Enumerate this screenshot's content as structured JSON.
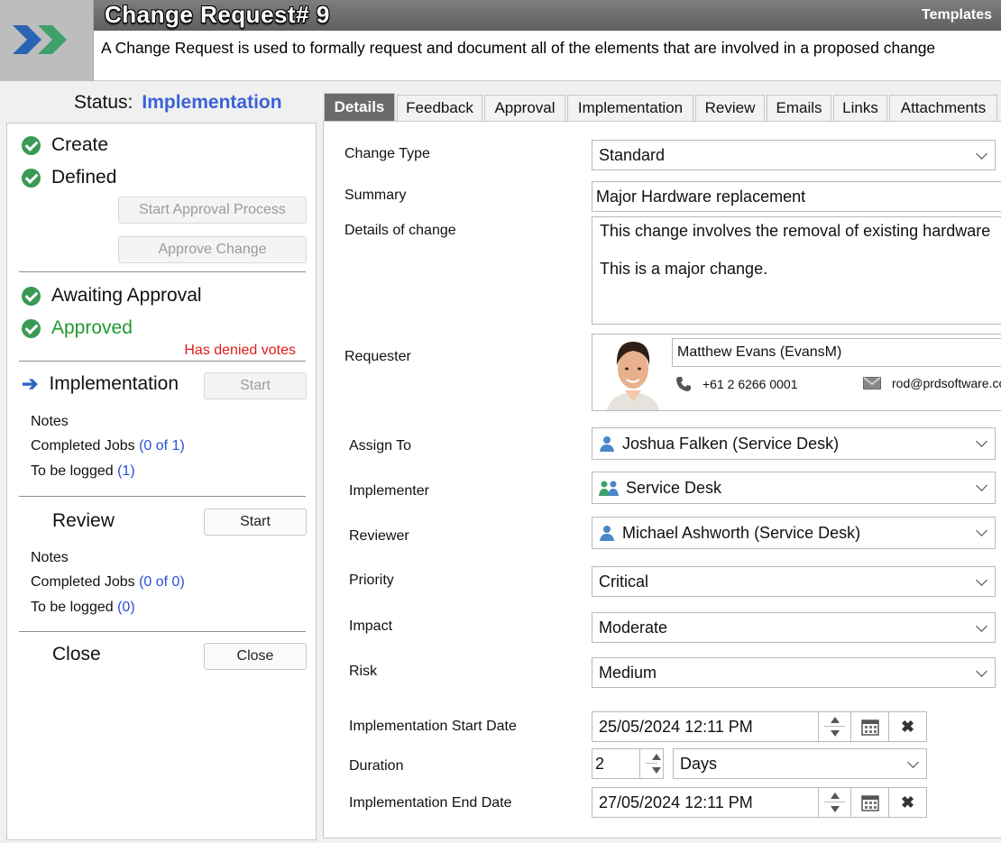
{
  "header": {
    "title": "Change Request# 9",
    "templates_label": "Templates",
    "description": "A Change Request is used to formally request and document all of the elements that are involved in a proposed change"
  },
  "status": {
    "label": "Status:",
    "value": "Implementation"
  },
  "workflow": {
    "create": "Create",
    "defined": "Defined",
    "start_approval_btn": "Start Approval Process",
    "approve_change_btn": "Approve Change",
    "awaiting_approval": "Awaiting Approval",
    "approved": "Approved",
    "denied_votes": "Has denied votes",
    "implementation": "Implementation",
    "implementation_start_btn": "Start",
    "impl_notes": "Notes",
    "impl_completed_label": "Completed Jobs",
    "impl_completed_value": "(0 of 1)",
    "impl_tobelogged_label": "To be logged",
    "impl_tobelogged_value": "(1)",
    "review": "Review",
    "review_start_btn": "Start",
    "review_notes": "Notes",
    "review_completed_label": "Completed Jobs",
    "review_completed_value": "(0 of 0)",
    "review_tobelogged_label": "To be logged",
    "review_tobelogged_value": "(0)",
    "close": "Close",
    "close_btn": "Close"
  },
  "tabs": [
    "Details",
    "Feedback",
    "Approval",
    "Implementation",
    "Review",
    "Emails",
    "Links",
    "Attachments"
  ],
  "form": {
    "change_type": {
      "label": "Change Type",
      "value": "Standard"
    },
    "summary": {
      "label": "Summary",
      "value": "Major Hardware replacement"
    },
    "details": {
      "label": "Details of change",
      "value": "This change involves the removal of existing hardware\n\nThis is a major change."
    },
    "requester": {
      "label": "Requester",
      "name": "Matthew Evans (EvansM)",
      "phone": "+61 2 6266 0001",
      "email": "rod@prdsoftware.com"
    },
    "assign_to": {
      "label": "Assign To",
      "value": "Joshua Falken (Service Desk)"
    },
    "implementer": {
      "label": "Implementer",
      "value": "Service Desk"
    },
    "reviewer": {
      "label": "Reviewer",
      "value": "Michael Ashworth (Service Desk)"
    },
    "priority": {
      "label": "Priority",
      "value": "Critical"
    },
    "impact": {
      "label": "Impact",
      "value": "Moderate"
    },
    "risk": {
      "label": "Risk",
      "value": "Medium"
    },
    "impl_start": {
      "label": "Implementation Start Date",
      "value": "25/05/2024 12:11 PM"
    },
    "duration": {
      "label": "Duration",
      "value": "2",
      "unit": "Days"
    },
    "impl_end": {
      "label": "Implementation End Date",
      "value": "27/05/2024 12:11 PM"
    }
  },
  "colors": {
    "status_blue": "#3b62d9",
    "check_green": "#3a9a54",
    "approved_green": "#1f9a2e",
    "denied_red": "#e21a1a",
    "link_blue": "#2b4fd6"
  }
}
